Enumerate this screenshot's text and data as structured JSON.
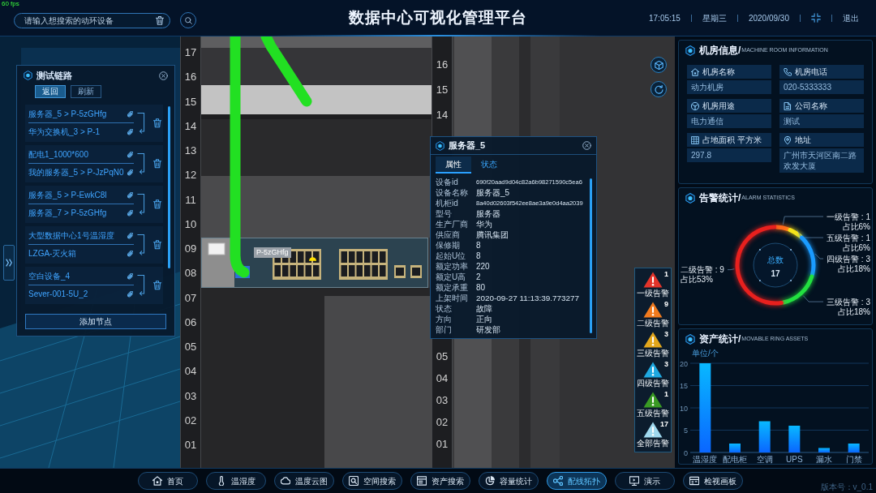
{
  "fps": "60 fps",
  "header": {
    "search": {
      "placeholder": "请输入想搜索的动环设备"
    },
    "title": "数据中心可视化管理平台",
    "time": "17:05:15",
    "weekday": "星期三",
    "date": "2020/09/30",
    "exit": "退出"
  },
  "scene": {
    "left_rail": [
      "17",
      "16",
      "15",
      "14",
      "13",
      "12",
      "11",
      "10",
      "09",
      "08",
      "07",
      "06",
      "05",
      "04",
      "03",
      "02",
      "01"
    ],
    "right_rail_upper": [
      "16",
      "15",
      "14"
    ],
    "right_rail_lower": [
      "05",
      "04",
      "03",
      "02",
      "01"
    ],
    "device_tag": "P-5zGHfg"
  },
  "link_panel": {
    "title": "测试链路",
    "buttons": [
      {
        "label": "返回",
        "selected": true
      },
      {
        "label": "刷新",
        "selected": false
      }
    ],
    "links": [
      {
        "from": "服务器_5 > P-5zGHfg",
        "to": "华为交换机_3 > P-1"
      },
      {
        "from": "配电1_1000*600",
        "to": "我的服务器_5 > P-JzPqN0"
      },
      {
        "from": "服务器_5 > P-EwkC8l",
        "to": "服务器_7 > P-5zGHfg"
      },
      {
        "from": "大型数据中心1号温湿度",
        "to": "LZGA-灭火箱"
      },
      {
        "from": "空白设备_4",
        "to": "Sever-001-5U_2"
      }
    ],
    "add_button": "添加节点"
  },
  "device_popup": {
    "title": "服务器_5",
    "tabs": [
      {
        "label": "属性",
        "selected": true
      },
      {
        "label": "状态",
        "selected": false
      }
    ],
    "properties": [
      {
        "label": "设备id",
        "value": "690f20aad9d04c82a6b98271590c5ea6"
      },
      {
        "label": "设备名称",
        "value": "服务器_5"
      },
      {
        "label": "机柜id",
        "value": "8a40d02603f542ee8ae3a9e0d4aa2039"
      },
      {
        "label": "型号",
        "value": "服务器"
      },
      {
        "label": "生产厂商",
        "value": "华为"
      },
      {
        "label": "供应商",
        "value": "腾讯集团"
      },
      {
        "label": "保修期",
        "value": "8"
      },
      {
        "label": "起始U位",
        "value": "8"
      },
      {
        "label": "额定功率",
        "value": "220"
      },
      {
        "label": "额定U高",
        "value": "2"
      },
      {
        "label": "额定承重",
        "value": "80"
      },
      {
        "label": "上架时间",
        "value": "2020-09-27 11:13:39.773277"
      },
      {
        "label": "状态",
        "value": "故障"
      },
      {
        "label": "方向",
        "value": "正向"
      },
      {
        "label": "部门",
        "value": "研发部"
      }
    ]
  },
  "alarm_levels": [
    {
      "label": "一级告警",
      "count": "1",
      "color": "#e3342a"
    },
    {
      "label": "二级告警",
      "count": "9",
      "color": "#f07a1e"
    },
    {
      "label": "三级告警",
      "count": "3",
      "color": "#e2a61c"
    },
    {
      "label": "四级告警",
      "count": "3",
      "color": "#1fa8e0"
    },
    {
      "label": "五级告警",
      "count": "1",
      "color": "#3a9a24"
    },
    {
      "label": "全部告警",
      "count": "17",
      "color": "#9fd8ee"
    }
  ],
  "machine_room": {
    "title": "机房信息/",
    "subtitle": "MACHINE ROOM INFORMATION",
    "fields": [
      {
        "label": "机房名称",
        "value": "动力机房"
      },
      {
        "label": "机房电话",
        "value": "020-5333333"
      },
      {
        "label": "机房用途",
        "value": "电力通信"
      },
      {
        "label": "公司名称",
        "value": "测试"
      },
      {
        "label": "占地面积 平方米",
        "value": "297.8"
      },
      {
        "label": "地址",
        "value": "广州市天河区南二路欢发大厦"
      }
    ]
  },
  "alarm_statistics": {
    "title": "告警统计/",
    "subtitle": "ALARM STATISTICS",
    "total_label": "总数",
    "total": "17",
    "chart_data": {
      "type": "donut",
      "categories": [
        "一级告警 : 1",
        "五级告警 : 1",
        "四级告警 : 3",
        "三级告警 : 3",
        "二级告警 : 9"
      ],
      "values": [
        1,
        1,
        3,
        3,
        9
      ],
      "value_labels": [
        "占比6%",
        "占比6%",
        "占比18%",
        "占比18%",
        "占比53%"
      ],
      "colors": [
        "#ff6a1a",
        "#f5e41a",
        "#1a9bff",
        "#22e040",
        "#e8201e"
      ]
    }
  },
  "asset_statistics": {
    "title": "资产统计/",
    "subtitle": "MOVABLE RING ASSETS",
    "chart_data": {
      "type": "bar",
      "ylabel": "单位/个",
      "categories": [
        "温湿度",
        "配电柜",
        "空调",
        "UPS",
        "漏水",
        "门禁"
      ],
      "values": [
        20,
        2,
        7,
        6,
        1,
        2
      ],
      "ylim": [
        0,
        20
      ],
      "yticks": [
        0,
        5,
        10,
        15,
        20
      ],
      "grid": true
    }
  },
  "nav": [
    {
      "label": "首页",
      "selected": false
    },
    {
      "label": "温湿度",
      "selected": false
    },
    {
      "label": "温度云图",
      "selected": false
    },
    {
      "label": "空间搜索",
      "selected": false
    },
    {
      "label": "资产搜索",
      "selected": false
    },
    {
      "label": "容量统计",
      "selected": false
    },
    {
      "label": "配线拓扑",
      "selected": true
    },
    {
      "label": "演示",
      "selected": false
    },
    {
      "label": "检视画板",
      "selected": false
    }
  ],
  "version": "版本号：v_0.1"
}
